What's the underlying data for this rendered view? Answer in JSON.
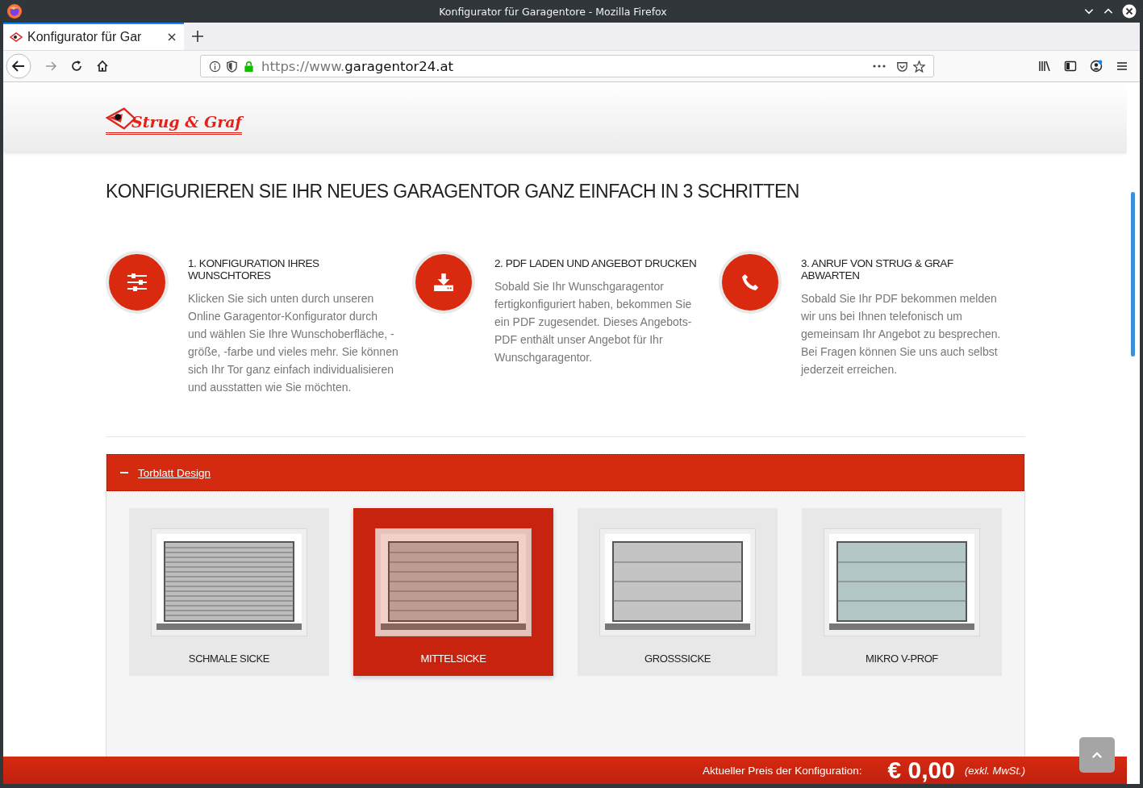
{
  "browser": {
    "window_title": "Konfigurator für Garagentore - Mozilla Firefox",
    "tab": {
      "title": "Konfigurator für Gar",
      "selected": true
    },
    "url_prefix": "https://www.",
    "url_domain": "garagentor24.at"
  },
  "header": {
    "logo": "Strug & Graf"
  },
  "headline": "KONFIGURIEREN SIE IHR NEUES GARAGENTOR GANZ EINFACH IN 3 SCHRITTEN",
  "steps": [
    {
      "kind": "sliders",
      "title": "1. KONFIGURATION IHRES WUNSCHTORES",
      "text": "Klicken Sie sich unten durch unseren Online Garagentor-Konfigurator durch und wählen Sie Ihre Wunschoberfläche, -größe, -farbe und vieles mehr. Sie können sich Ihr Tor ganz einfach individualisieren und ausstatten wie Sie möchten."
    },
    {
      "kind": "download",
      "title": "2. PDF LADEN UND ANGEBOT DRUCKEN",
      "text": "Sobald Sie Ihr Wunschgaragentor fertigkonfiguriert haben, bekommen Sie ein PDF zugesendet. Dieses Angebots-PDF enthält unser Angebot für Ihr Wunschgaragentor."
    },
    {
      "kind": "phone",
      "title": "3. ANRUF VON STRUG & GRAF ABWARTEN",
      "text": "Sobald Sie Ihr PDF bekommen melden wir uns bei Ihnen telefonisch um gemeinsam Ihr Angebot zu besprechen. Bei Fragen können Sie uns auch selbst jederzeit erreichen."
    }
  ],
  "accordion": {
    "title": "Torblatt Design",
    "expanded": true,
    "options": [
      {
        "label": "SCHMALE SICKE",
        "kind": "narrow",
        "selected": false
      },
      {
        "label": "MITTELSICKE",
        "kind": "medium",
        "selected": true
      },
      {
        "label": "GROSSSICKE",
        "kind": "large",
        "selected": false
      },
      {
        "label": "MIKRO V-PROF",
        "kind": "micro",
        "selected": false
      }
    ]
  },
  "price_bar": {
    "label": "Aktueller Preis der Konfiguration:",
    "price": "€ 0,00",
    "note": "(exkl. MwSt.)"
  }
}
